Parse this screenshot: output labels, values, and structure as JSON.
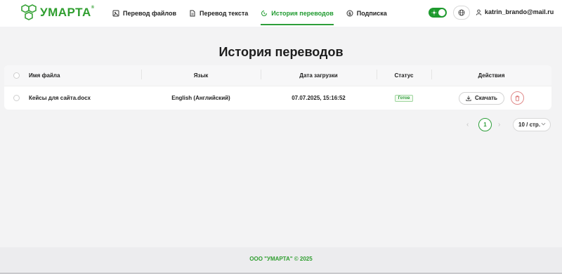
{
  "logo": {
    "text": "УМАРТА",
    "reg": "®"
  },
  "nav": {
    "items": [
      {
        "label": "Перевод файлов",
        "icon": "file-image-icon"
      },
      {
        "label": "Перевод текста",
        "icon": "document-icon"
      },
      {
        "label": "История переводов",
        "icon": "history-icon",
        "active": true
      },
      {
        "label": "Подписка",
        "icon": "dollar-icon"
      }
    ]
  },
  "header": {
    "theme_toggle_on": true,
    "user_email": "katrin_brando@mail.ru"
  },
  "page": {
    "title": "История переводов"
  },
  "table": {
    "columns": [
      "Имя файла",
      "Язык",
      "Дата загрузки",
      "Статус",
      "Действия"
    ],
    "rows": [
      {
        "file": "Кейсы для сайта.docx",
        "language": "English (Английский)",
        "date": "07.07.2025, 15:16:52",
        "status": "Готов",
        "download_label": "Скачать"
      }
    ]
  },
  "pagination": {
    "current": "1",
    "page_size": "10 / стр."
  },
  "footer": {
    "text": "ООО \"УМАРТА\" © 2025"
  },
  "colors": {
    "accent": "#2e9e3a",
    "danger": "#e08a8a"
  }
}
